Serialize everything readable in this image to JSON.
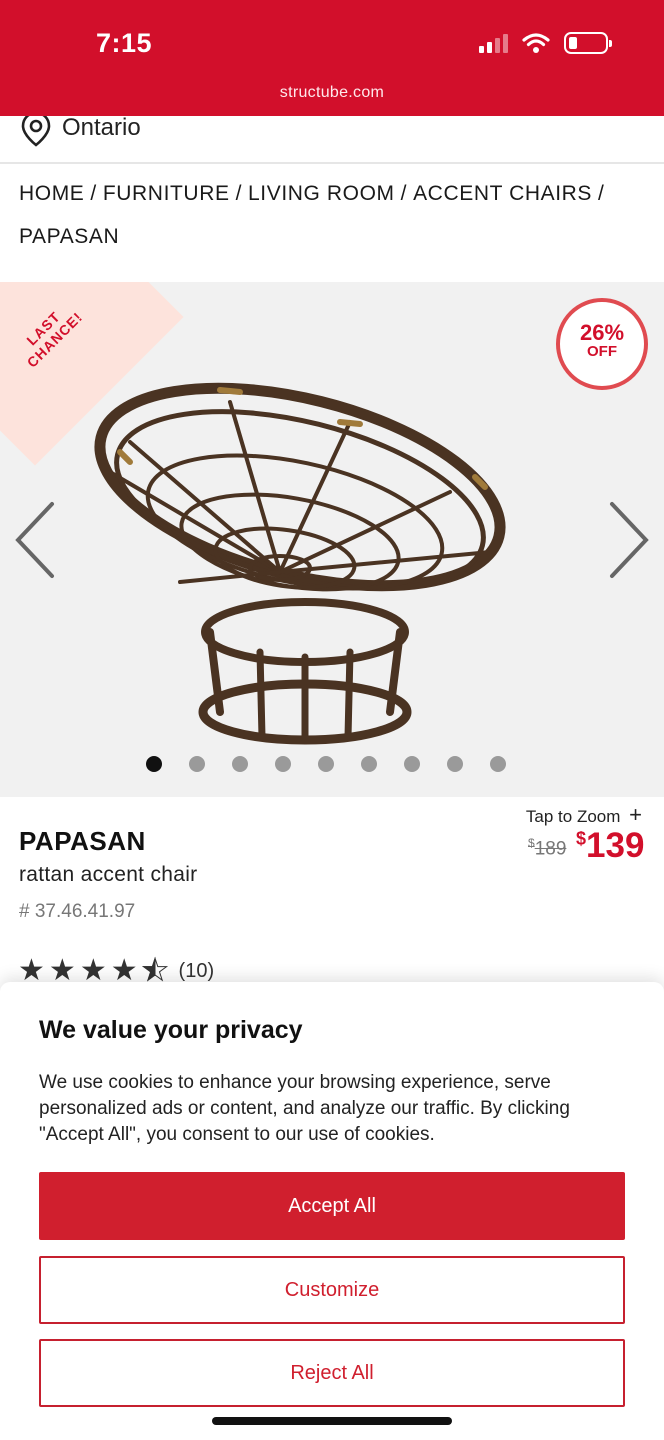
{
  "status_bar": {
    "time": "7:15",
    "icons": [
      "signal-icon",
      "wifi-icon",
      "battery-icon"
    ]
  },
  "browser": {
    "url": "structube.com"
  },
  "location": {
    "label": "Ontario",
    "icon": "location-pin-icon"
  },
  "breadcrumb": {
    "items": [
      "HOME",
      "FURNITURE",
      "LIVING ROOM",
      "ACCENT CHAIRS",
      "PAPASAN"
    ],
    "separator": "/"
  },
  "gallery": {
    "ribbon": "LAST CHANCE!",
    "badge_percent": "26%",
    "badge_label": "OFF",
    "image_count": 9,
    "active_index": 0
  },
  "product": {
    "zoom_label": "Tap to Zoom",
    "zoom_icon": "+",
    "name": "PAPASAN",
    "subtitle": "rattan accent chair",
    "sku": "# 37.46.41.97",
    "price_currency": "$",
    "price_old": "189",
    "price_new": "139",
    "rating_value": 4.5,
    "rating_max": 5,
    "rating_count": "(10)"
  },
  "cookie": {
    "title": "We value your privacy",
    "body": "We use cookies to enhance your browsing experience, serve personalized ads or content, and analyze our traffic. By clicking \"Accept All\", you consent to our use of cookies.",
    "accept": "Accept All",
    "customize": "Customize",
    "reject": "Reject All"
  },
  "colors": {
    "brand": "#d20f2b",
    "button": "#d01f2e",
    "ribbon": "#fde3dc"
  }
}
